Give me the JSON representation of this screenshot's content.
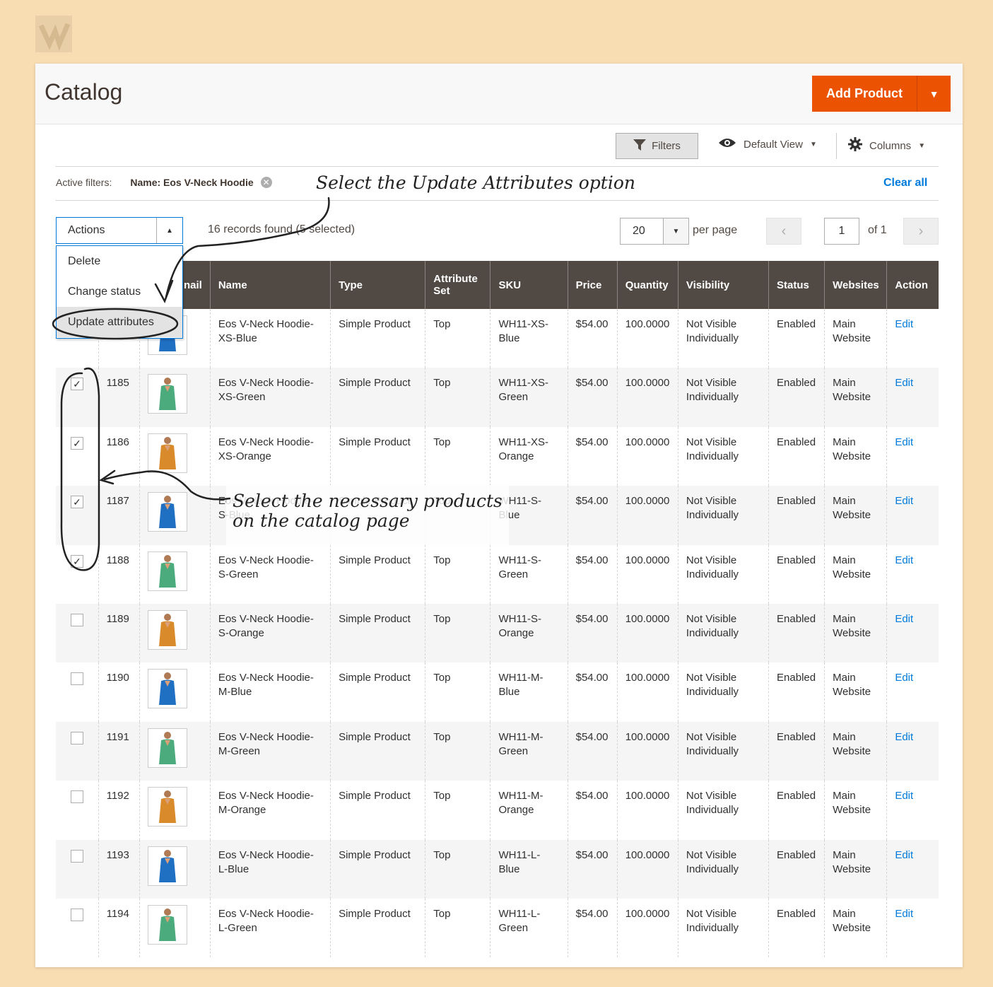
{
  "page": {
    "title": "Catalog"
  },
  "header": {
    "add_product_label": "Add Product"
  },
  "toolbar": {
    "filters_label": "Filters",
    "view_label": "Default View",
    "columns_label": "Columns"
  },
  "active_filters": {
    "label": "Active filters:",
    "value": "Name: Eos V-Neck Hoodie",
    "clear_all": "Clear all"
  },
  "actions": {
    "label": "Actions",
    "items": [
      "Delete",
      "Change status",
      "Update attributes"
    ]
  },
  "records_text": "16 records found (5 selected)",
  "pagination": {
    "per_page": "20",
    "per_page_label": "per page",
    "page": "1",
    "of_label": "of 1"
  },
  "columns": [
    "",
    "",
    "nail",
    "Name",
    "Type",
    "Attribute Set",
    "SKU",
    "Price",
    "Quantity",
    "Visibility",
    "Status",
    "Websites",
    "Action"
  ],
  "rows": [
    {
      "id": "",
      "checked": true,
      "color": "blue",
      "name": "Eos V-Neck Hoodie-XS-Blue",
      "type": "Simple Product",
      "attr_set": "Top",
      "sku": "WH11-XS-Blue",
      "price": "$54.00",
      "qty": "100.0000",
      "visibility": "Not Visible Individually",
      "status": "Enabled",
      "website": "Main Website",
      "action": "Edit"
    },
    {
      "id": "1185",
      "checked": true,
      "color": "green",
      "name": "Eos V-Neck Hoodie-XS-Green",
      "type": "Simple Product",
      "attr_set": "Top",
      "sku": "WH11-XS-Green",
      "price": "$54.00",
      "qty": "100.0000",
      "visibility": "Not Visible Individually",
      "status": "Enabled",
      "website": "Main Website",
      "action": "Edit"
    },
    {
      "id": "1186",
      "checked": true,
      "color": "orange",
      "name": "Eos V-Neck Hoodie-XS-Orange",
      "type": "Simple Product",
      "attr_set": "Top",
      "sku": "WH11-XS-Orange",
      "price": "$54.00",
      "qty": "100.0000",
      "visibility": "Not Visible Individually",
      "status": "Enabled",
      "website": "Main Website",
      "action": "Edit"
    },
    {
      "id": "1187",
      "checked": true,
      "color": "blue",
      "name": "Eos V-Neck Hoodie-S-Blue",
      "type": "Simple Product",
      "attr_set": "Top",
      "sku": "WH11-S-Blue",
      "price": "$54.00",
      "qty": "100.0000",
      "visibility": "Not Visible Individually",
      "status": "Enabled",
      "website": "Main Website",
      "action": "Edit"
    },
    {
      "id": "1188",
      "checked": true,
      "color": "green",
      "name": "Eos V-Neck Hoodie-S-Green",
      "type": "Simple Product",
      "attr_set": "Top",
      "sku": "WH11-S-Green",
      "price": "$54.00",
      "qty": "100.0000",
      "visibility": "Not Visible Individually",
      "status": "Enabled",
      "website": "Main Website",
      "action": "Edit"
    },
    {
      "id": "1189",
      "checked": false,
      "color": "orange",
      "name": "Eos V-Neck Hoodie-S-Orange",
      "type": "Simple Product",
      "attr_set": "Top",
      "sku": "WH11-S-Orange",
      "price": "$54.00",
      "qty": "100.0000",
      "visibility": "Not Visible Individually",
      "status": "Enabled",
      "website": "Main Website",
      "action": "Edit"
    },
    {
      "id": "1190",
      "checked": false,
      "color": "blue",
      "name": "Eos V-Neck Hoodie-M-Blue",
      "type": "Simple Product",
      "attr_set": "Top",
      "sku": "WH11-M-Blue",
      "price": "$54.00",
      "qty": "100.0000",
      "visibility": "Not Visible Individually",
      "status": "Enabled",
      "website": "Main Website",
      "action": "Edit"
    },
    {
      "id": "1191",
      "checked": false,
      "color": "green",
      "name": "Eos V-Neck Hoodie-M-Green",
      "type": "Simple Product",
      "attr_set": "Top",
      "sku": "WH11-M-Green",
      "price": "$54.00",
      "qty": "100.0000",
      "visibility": "Not Visible Individually",
      "status": "Enabled",
      "website": "Main Website",
      "action": "Edit"
    },
    {
      "id": "1192",
      "checked": false,
      "color": "orange",
      "name": "Eos V-Neck Hoodie-M-Orange",
      "type": "Simple Product",
      "attr_set": "Top",
      "sku": "WH11-M-Orange",
      "price": "$54.00",
      "qty": "100.0000",
      "visibility": "Not Visible Individually",
      "status": "Enabled",
      "website": "Main Website",
      "action": "Edit"
    },
    {
      "id": "1193",
      "checked": false,
      "color": "blue",
      "name": "Eos V-Neck Hoodie-L-Blue",
      "type": "Simple Product",
      "attr_set": "Top",
      "sku": "WH11-L-Blue",
      "price": "$54.00",
      "qty": "100.0000",
      "visibility": "Not Visible Individually",
      "status": "Enabled",
      "website": "Main Website",
      "action": "Edit"
    },
    {
      "id": "1194",
      "checked": false,
      "color": "green",
      "name": "Eos V-Neck Hoodie-L-Green",
      "type": "Simple Product",
      "attr_set": "Top",
      "sku": "WH11-L-Green",
      "price": "$54.00",
      "qty": "100.0000",
      "visibility": "Not Visible Individually",
      "status": "Enabled",
      "website": "Main Website",
      "action": "Edit"
    }
  ],
  "annotations": {
    "update_attr": "Select the Update Attributes option",
    "select_products_1": "Select the necessary products",
    "select_products_2": "on the catalog page"
  },
  "colors": {
    "accent": "#eb5202",
    "header_bg": "#514943",
    "link": "#007bdb",
    "page_bg": "#f8dcb2",
    "blue": "#1f6fc2",
    "green": "#4bab7c",
    "orange": "#d98a2b"
  },
  "icons": {
    "logo": "bss-logo-icon",
    "filter": "funnel-icon",
    "view": "eye-icon",
    "columns": "gear-icon",
    "remove": "close-circle-icon"
  }
}
